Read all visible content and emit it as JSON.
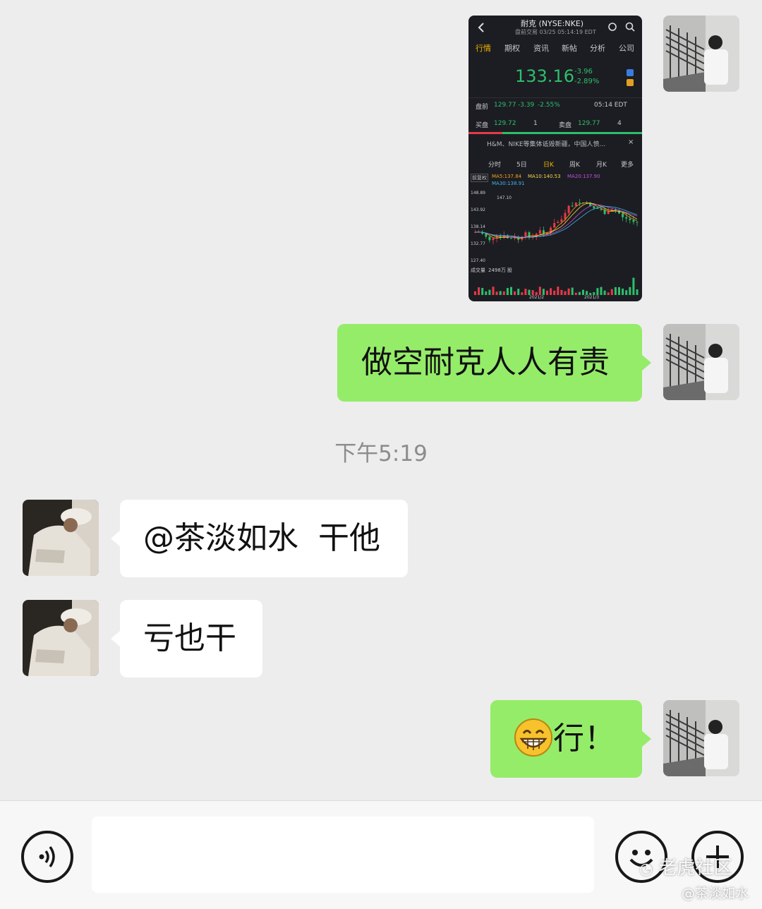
{
  "messages": [
    {
      "side": "mine",
      "kind": "image"
    },
    {
      "side": "mine",
      "text": "做空耐克人人有责"
    },
    {
      "side": "theirs",
      "text": "@茶淡如水  干他"
    },
    {
      "side": "theirs",
      "text": "亏也干"
    },
    {
      "side": "mine",
      "text": "行！",
      "emoji": "grinning-face"
    }
  ],
  "timestamp": "下午5:19",
  "stock_shot": {
    "title": "耐克 (NYSE:NKE)",
    "subtitle": "盘前交易 03/25 05:14:19 EDT",
    "tabs": [
      "行情",
      "期权",
      "资讯",
      "新帖",
      "分析",
      "公司"
    ],
    "price": "133.16",
    "change": "-3.96",
    "change_pct": "-2.89%",
    "premarket_label": "盘前",
    "premarket_price": "129.77",
    "premarket_change": "-3.39",
    "premarket_pct": "-2.55%",
    "premarket_time": "05:14 EDT",
    "bid_label": "买盘",
    "bid_price": "129.72",
    "bid_size": "1",
    "ask_label": "卖盘",
    "ask_price": "129.77",
    "ask_size": "4",
    "news": "H&M、NIKE等集体诋毁新疆，中国人愤...",
    "period_tabs": [
      "分时",
      "5日",
      "日K",
      "周K",
      "月K",
      "更多"
    ],
    "adj_label": "前复权",
    "ma5": "MA5:137.84",
    "ma10": "MA10:140.53",
    "ma20": "MA20:137.90",
    "ma30": "MA30:138.91",
    "y_ticks": [
      "148.89",
      "143.92",
      "138.14",
      "132.77",
      "127.40"
    ],
    "peak_label": "147.10",
    "volume_label": "成交量",
    "volume_value": "2498万 股",
    "date_ticks": [
      "2021/2",
      "2021/3"
    ],
    "colors": {
      "up": "#e8394a",
      "down": "#2dbf6c",
      "ma5": "#f0a020",
      "ma10": "#f5d547",
      "ma20": "#c050e0",
      "ma30": "#3db5e8"
    }
  },
  "input_bar": {
    "left_icon": "voice-icon",
    "right_icons": [
      "emoji-icon",
      "plus-icon"
    ]
  },
  "watermark": {
    "line1": "老虎社区",
    "line2": "@茶淡如水"
  }
}
